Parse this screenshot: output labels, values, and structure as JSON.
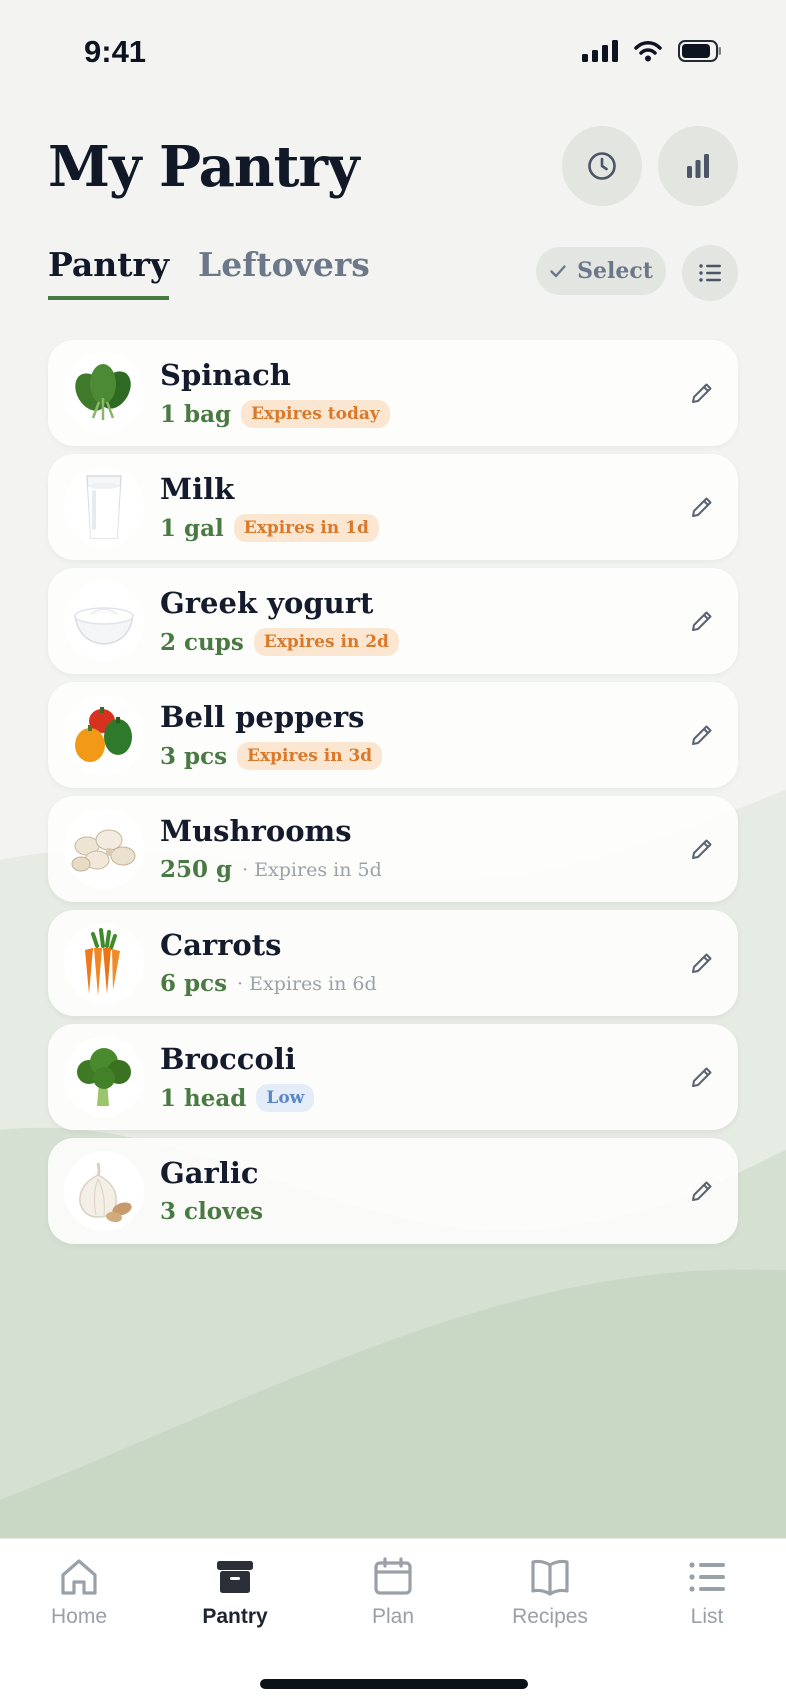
{
  "status_bar": {
    "time": "9:41"
  },
  "header": {
    "title": "My Pantry",
    "history_icon": "clock-icon",
    "stats_icon": "bar-chart-icon"
  },
  "tabs": [
    {
      "label": "Pantry",
      "active": true
    },
    {
      "label": "Leftovers",
      "active": false
    }
  ],
  "toolbar": {
    "select_label": "Select",
    "select_icon": "check-icon",
    "list_icon": "list-icon"
  },
  "items": [
    {
      "name": "Spinach",
      "quantity": "1 bag",
      "expiry": "Expires today",
      "expiry_style": "badge-orange",
      "image": "spinach-image"
    },
    {
      "name": "Milk",
      "quantity": "1 gal",
      "expiry": "Expires in 1d",
      "expiry_style": "badge-orange",
      "image": "milk-image"
    },
    {
      "name": "Greek yogurt",
      "quantity": "2 cups",
      "expiry": "Expires in 2d",
      "expiry_style": "badge-orange",
      "image": "yogurt-image"
    },
    {
      "name": "Bell peppers",
      "quantity": "3 pcs",
      "expiry": "Expires in 3d",
      "expiry_style": "badge-orange",
      "image": "bell-peppers-image"
    },
    {
      "name": "Mushrooms",
      "quantity": "250 g",
      "expiry": "· Expires in 5d",
      "expiry_style": "plain",
      "image": "mushrooms-image"
    },
    {
      "name": "Carrots",
      "quantity": "6 pcs",
      "expiry": "· Expires in 6d",
      "expiry_style": "plain",
      "image": "carrots-image"
    },
    {
      "name": "Broccoli",
      "quantity": "1 head",
      "expiry": "Low",
      "expiry_style": "badge-blue",
      "image": "broccoli-image"
    },
    {
      "name": "Garlic",
      "quantity": "3 cloves",
      "expiry": "",
      "expiry_style": "none",
      "image": "garlic-image"
    }
  ],
  "nav": [
    {
      "label": "Home",
      "icon": "home-icon",
      "active": false
    },
    {
      "label": "Pantry",
      "icon": "pantry-box-icon",
      "active": true
    },
    {
      "label": "Plan",
      "icon": "calendar-icon",
      "active": false
    },
    {
      "label": "Recipes",
      "icon": "book-icon",
      "active": false
    },
    {
      "label": "List",
      "icon": "list-icon",
      "active": false
    }
  ],
  "colors": {
    "accent_green": "#4a7a43",
    "expiry_orange": "#d9792b",
    "low_blue": "#5b86c6",
    "text_dark": "#141b2c",
    "muted": "#6c7789"
  }
}
